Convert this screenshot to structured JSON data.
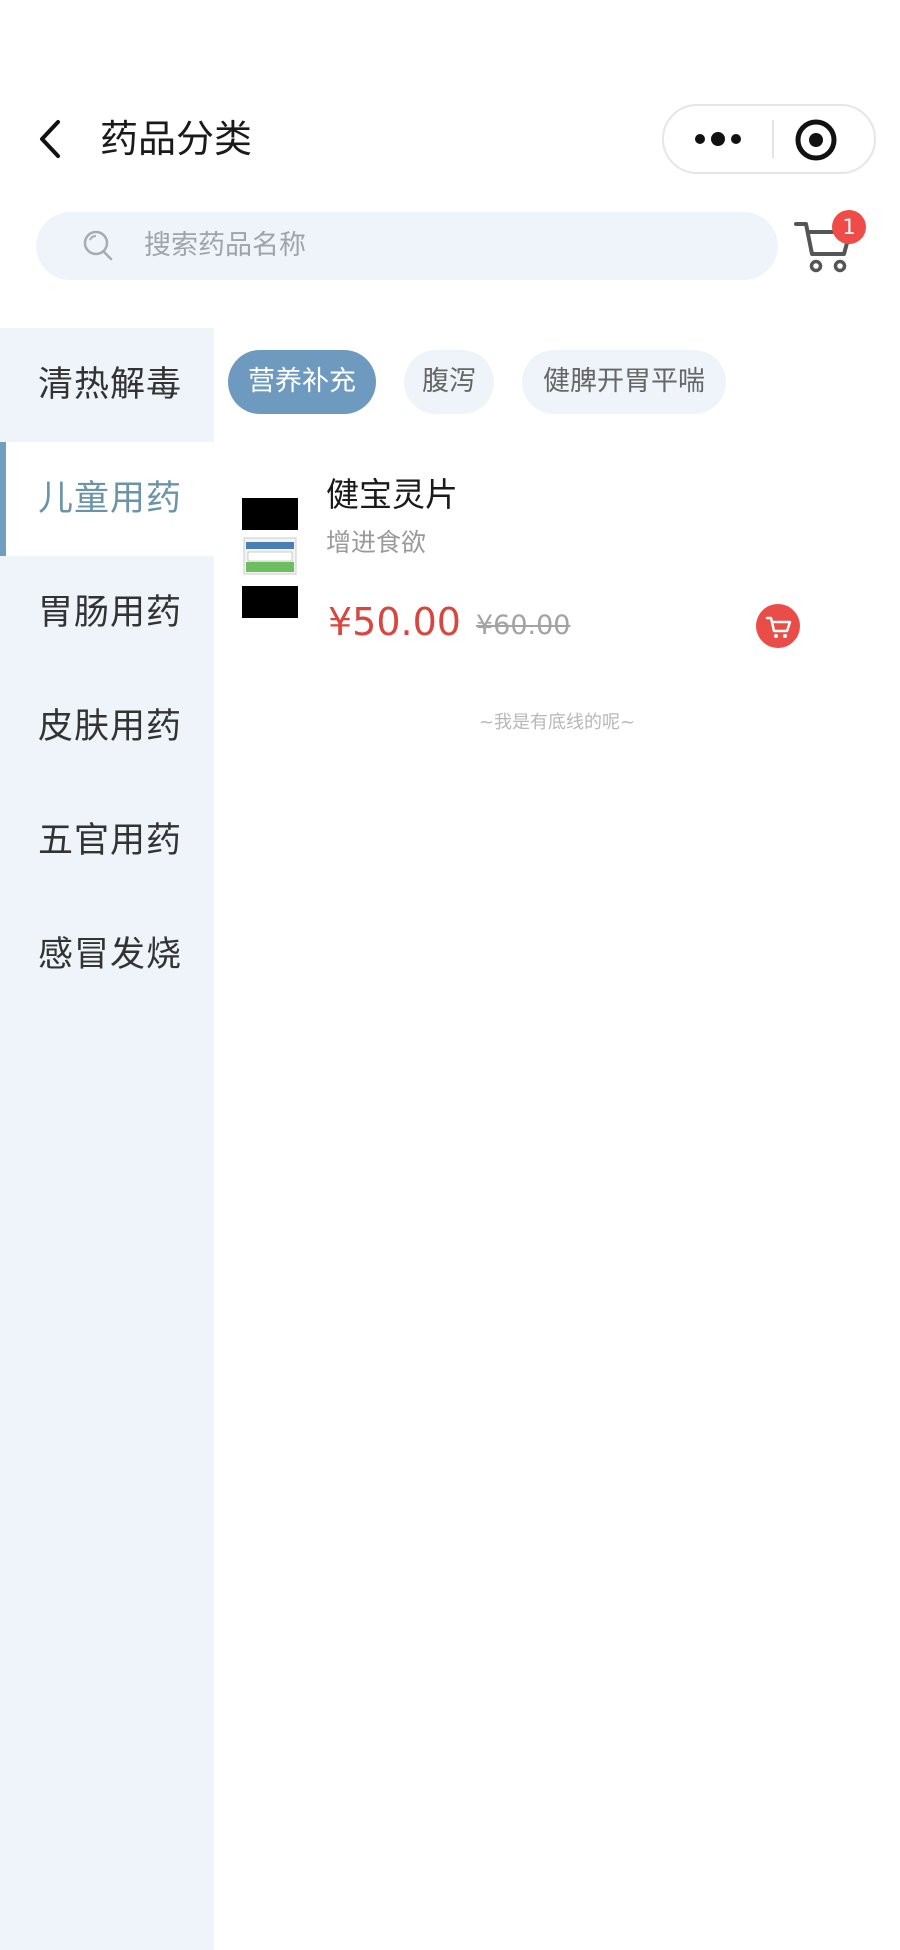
{
  "header": {
    "title": "药品分类"
  },
  "search": {
    "placeholder": "搜索药品名称"
  },
  "cart": {
    "badge_count": "1"
  },
  "sidebar": {
    "items": [
      {
        "label": "清热解毒",
        "active": false
      },
      {
        "label": "儿童用药",
        "active": true
      },
      {
        "label": "胃肠用药",
        "active": false
      },
      {
        "label": "皮肤用药",
        "active": false
      },
      {
        "label": "五官用药",
        "active": false
      },
      {
        "label": "感冒发烧",
        "active": false
      }
    ]
  },
  "subcategories": [
    {
      "label": "营养补充",
      "active": true
    },
    {
      "label": "腹泻",
      "active": false
    },
    {
      "label": "健脾开胃平喘",
      "active": false
    }
  ],
  "products": [
    {
      "name": "健宝灵片",
      "description": "增进食欲",
      "price": "¥50.00",
      "original_price": "¥60.00"
    }
  ],
  "list_end_text": "~我是有底线的呢~",
  "colors": {
    "accent_blue": "#6e9ac0",
    "price_red": "#d9463f",
    "sidebar_bg": "#eff4fb",
    "badge_red": "#ef4b48"
  },
  "icons": {
    "back": "chevron-left-icon",
    "more": "more-dots-icon",
    "mini_program_close": "target-icon",
    "search": "search-icon",
    "cart": "cart-icon",
    "add_to_cart": "cart-plus-icon"
  }
}
